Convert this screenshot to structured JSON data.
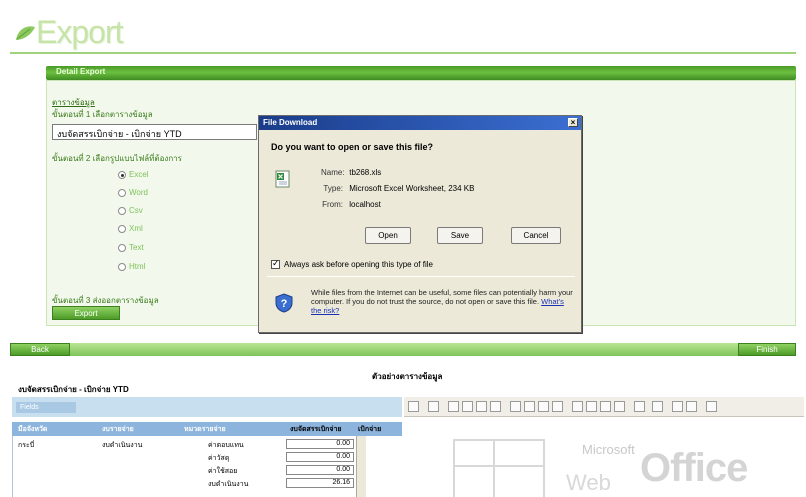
{
  "header": {
    "title": "Export"
  },
  "detail": {
    "section_title": "Detail Export",
    "data_table_link": "ตารางข้อมูล",
    "step1_label": "ขั้นตอนที่ 1 เลือกตารางข้อมูล",
    "selected_table": "งบจัดสรรเบิกจ่าย - เบิกจ่าย YTD",
    "step2_label": "ขั้นตอนที่ 2 เลือกรูปแบบไฟล์ที่ต้องการ",
    "formats": [
      {
        "label": "Excel",
        "selected": true
      },
      {
        "label": "Word",
        "selected": false
      },
      {
        "label": "Csv",
        "selected": false
      },
      {
        "label": "Xml",
        "selected": false
      },
      {
        "label": "Text",
        "selected": false
      },
      {
        "label": "Html",
        "selected": false
      }
    ],
    "step3_label": "ขั้นตอนที่ 3 ส่งออกตารางข้อมูล",
    "export_button": "Export"
  },
  "dialog": {
    "title": "File Download",
    "close_symbol": "×",
    "question": "Do you want to open or save this file?",
    "name_key": "Name:",
    "name_value": "tb268.xls",
    "type_key": "Type:",
    "type_value": "Microsoft Excel Worksheet, 234 KB",
    "from_key": "From:",
    "from_value": "localhost",
    "open_button": "Open",
    "save_button": "Save",
    "cancel_button": "Cancel",
    "checkbox_label": "Always ask before opening this type of file",
    "checkbox_checked": true,
    "warning_text": "While files from the Internet can be useful, some files can potentially harm your computer. If you do not trust the source, do not open or save this file.",
    "warning_link": "What's the risk?"
  },
  "nav": {
    "back": "Back",
    "finish": "Finish"
  },
  "sample": {
    "title": "ตัวอย่างตารางข้อมูล",
    "pivot_title": "งบจัดสรรเบิกจ่าย - เบิกจ่าย YTD",
    "filter_label": "Fields",
    "headers": [
      "มือจังหวัด",
      "งบรายจ่าย",
      "หมวดรายจ่าย",
      "งบจัดสรรเบิกจ่าย",
      "เบิกจ่าย"
    ],
    "row_province": "กระบี่",
    "row_budget": "งบดำเนินงาน",
    "rows": [
      {
        "category": "ค่าตอบแทน",
        "value": "0.00"
      },
      {
        "category": "ค่าวัสดุ",
        "value": "0.00"
      },
      {
        "category": "ค่าใช้สอย",
        "value": "0.00"
      },
      {
        "category": "งบดำเนินงาน",
        "value": "26.16"
      }
    ]
  },
  "office": {
    "brand_small": "Microsoft",
    "brand_large": "Office",
    "brand_web": "Web"
  },
  "colors": {
    "accent_green": "#6cc040",
    "dialog_title": "#1a3c8a",
    "pivot_header": "#8db4dc"
  }
}
